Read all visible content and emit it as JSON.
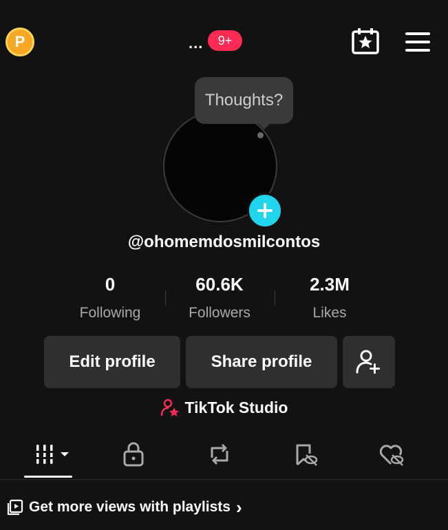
{
  "header": {
    "coin_letter": "P",
    "more_dots": "...",
    "notification_count": "9+",
    "icons": [
      "coin-icon",
      "calendar-star-icon",
      "menu-icon"
    ]
  },
  "tooltip": {
    "text": "Thoughts?"
  },
  "profile": {
    "username": "@ohomemdosmilcontos",
    "stats": [
      {
        "value": "0",
        "label": "Following"
      },
      {
        "value": "60.6K",
        "label": "Followers"
      },
      {
        "value": "2.3M",
        "label": "Likes"
      }
    ]
  },
  "actions": {
    "edit_profile": "Edit profile",
    "share_profile": "Share profile",
    "studio_label": "TikTok Studio"
  },
  "tabs": [
    "videos-grid-icon",
    "private-lock-icon",
    "repost-icon",
    "favorites-hidden-icon",
    "liked-hidden-icon"
  ],
  "playlist_prompt": {
    "text": "Get more views with playlists",
    "chevron": "›"
  },
  "colors": {
    "accent_red": "#fe2c55",
    "accent_cyan": "#20d5ec",
    "coin_gold": "#f7a823",
    "background": "#121212",
    "button_bg": "#2f2f2f"
  }
}
